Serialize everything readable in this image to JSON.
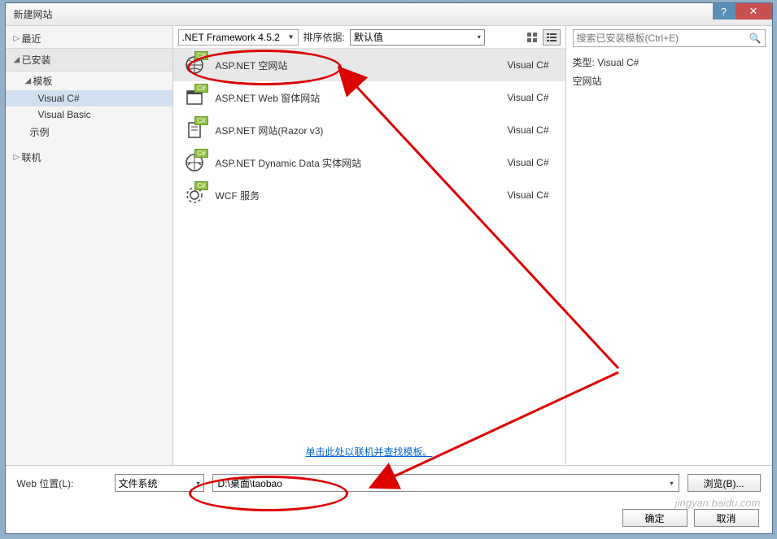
{
  "titlebar": {
    "title": "新建网站"
  },
  "tree": {
    "recent": "最近",
    "installed": "已安装",
    "templates": "模板",
    "visual_csharp": "Visual C#",
    "visual_basic": "Visual Basic",
    "sample": "示例",
    "online": "联机"
  },
  "filter": {
    "framework": ".NET Framework 4.5.2",
    "sort_label": "排序依据:",
    "sort_value": "默认值"
  },
  "templates": [
    {
      "name": "ASP.NET 空网站",
      "lang": "Visual C#"
    },
    {
      "name": "ASP.NET Web 窗体网站",
      "lang": "Visual C#"
    },
    {
      "name": "ASP.NET 网站(Razor v3)",
      "lang": "Visual C#"
    },
    {
      "name": "ASP.NET Dynamic Data 实体网站",
      "lang": "Visual C#"
    },
    {
      "name": "WCF 服务",
      "lang": "Visual C#"
    }
  ],
  "online_link": "单击此处以联机并查找模板。",
  "search": {
    "placeholder": "搜索已安装模板(Ctrl+E)"
  },
  "info": {
    "type_label": "类型:",
    "type_value": "Visual C#",
    "desc": "空网站"
  },
  "bottom": {
    "label": "Web 位置(L):",
    "loc_type": "文件系统",
    "path": "D:\\桌面\\taobao",
    "browse": "浏览(B)..."
  },
  "footer": {
    "ok": "确定",
    "cancel": "取消"
  },
  "watermark": "jingyan.baidu.com"
}
